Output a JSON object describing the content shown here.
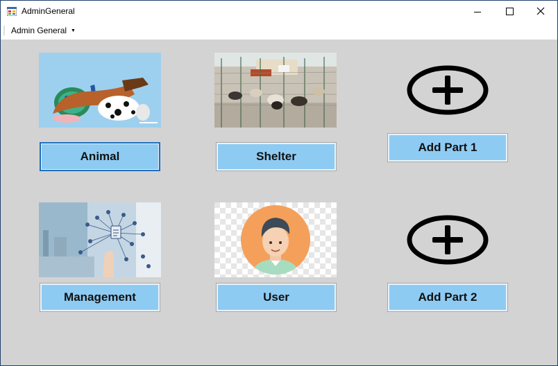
{
  "window": {
    "title": "AdminGeneral"
  },
  "menu": {
    "admin_general": "Admin General"
  },
  "buttons": {
    "animal": "Animal",
    "shelter": "Shelter",
    "add_part_1": "Add Part 1",
    "management": "Management",
    "user": "User",
    "add_part_2": "Add Part 2"
  },
  "colors": {
    "button_fill": "#8ecbf3",
    "button_focus_border": "#1f6fba",
    "client_background": "#d3d3d3",
    "window_border": "#1e3f6e"
  },
  "icons": [
    "app-icon",
    "minimize-icon",
    "maximize-icon",
    "close-icon",
    "add-circle-icon"
  ]
}
